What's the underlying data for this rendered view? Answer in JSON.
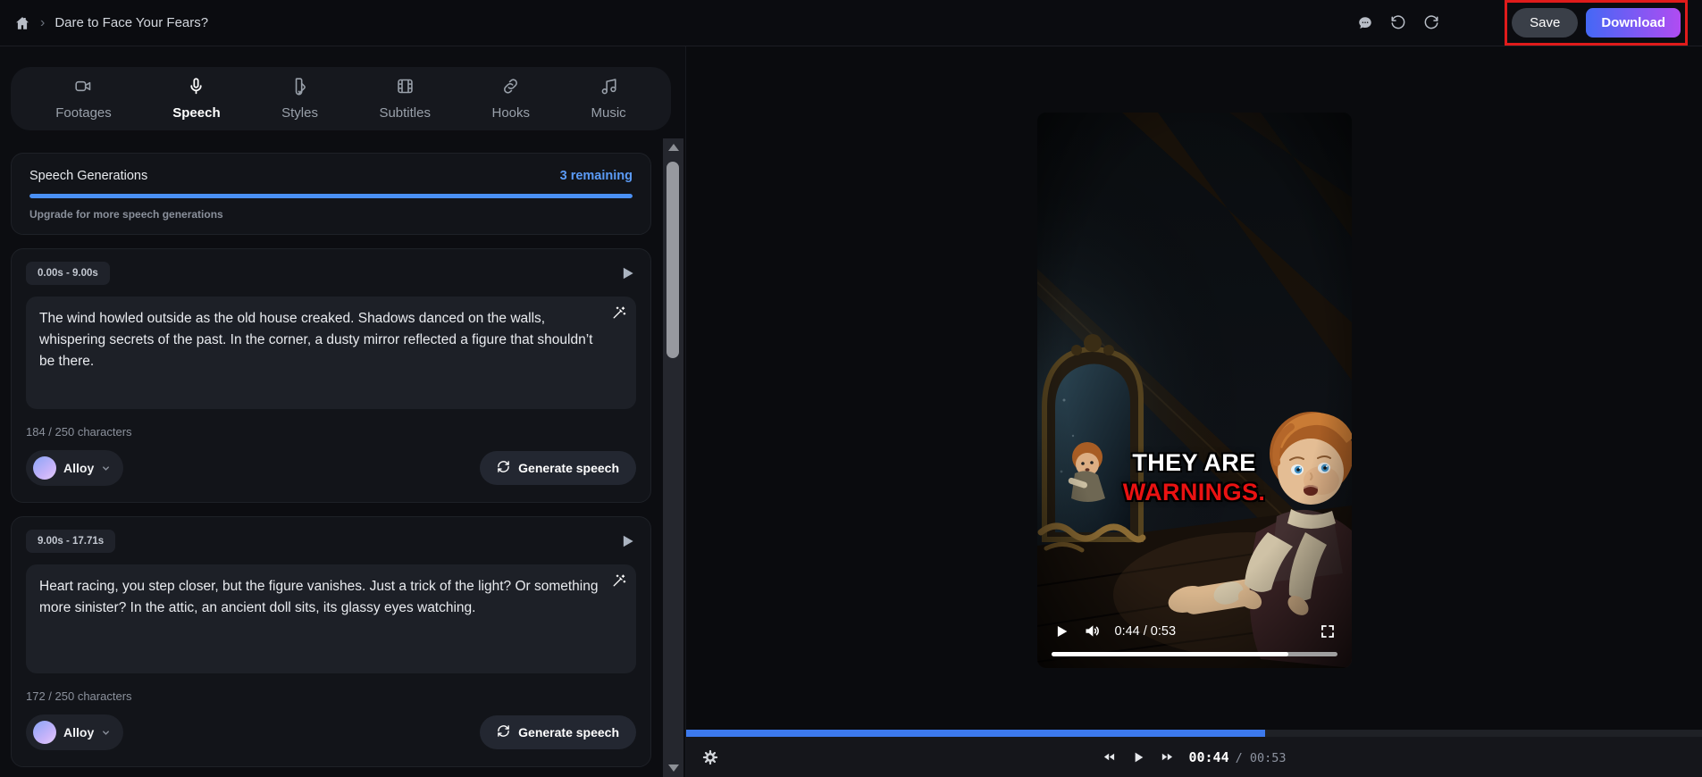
{
  "header": {
    "breadcrumb_title": "Dare to Face Your Fears?",
    "save_label": "Save",
    "download_label": "Download"
  },
  "icons": {
    "breadcrumb": "home-icon",
    "header_right": [
      "message-icon",
      "undo-icon",
      "redo-icon"
    ],
    "segment": [
      "play-icon",
      "magic-wand-icon",
      "refresh-icon",
      "chevron-down-icon"
    ],
    "player": [
      "play-icon",
      "volume-icon",
      "fullscreen-icon"
    ],
    "transport": [
      "gear-icon",
      "rewind-icon",
      "play-icon",
      "fast-forward-icon"
    ]
  },
  "tabs": [
    {
      "label": "Footages",
      "icon": "video-camera-icon",
      "active": false
    },
    {
      "label": "Speech",
      "icon": "microphone-icon",
      "active": true
    },
    {
      "label": "Styles",
      "icon": "palette-icon",
      "active": false
    },
    {
      "label": "Subtitles",
      "icon": "film-icon",
      "active": false
    },
    {
      "label": "Hooks",
      "icon": "link-icon",
      "active": false
    },
    {
      "label": "Music",
      "icon": "music-note-icon",
      "active": false
    }
  ],
  "speech_generations": {
    "title": "Speech Generations",
    "remaining_label": "3 remaining",
    "upgrade_label": "Upgrade for more speech generations",
    "progress_percent": 100
  },
  "segments": [
    {
      "time_range": "0.00s - 9.00s",
      "text": "The wind howled outside as the old house creaked. Shadows danced on the walls, whispering secrets of the past. In the corner, a dusty mirror reflected a figure that shouldn’t be there.",
      "char_count": "184 / 250 characters",
      "voice": "Alloy",
      "generate_label": "Generate speech"
    },
    {
      "time_range": "9.00s - 17.71s",
      "text": "Heart racing, you step closer, but the figure vanishes. Just a trick of the light? Or something more sinister? In the attic, an ancient doll sits, its glassy eyes watching.",
      "char_count": "172 / 250 characters",
      "voice": "Alloy",
      "generate_label": "Generate speech"
    }
  ],
  "player": {
    "caption_line1": "THEY ARE",
    "caption_line2": "WARNINGS.",
    "time_display": "0:44 / 0:53",
    "progress_percent": 83
  },
  "timeline": {
    "progress_percent": 57,
    "current_time": "00:44",
    "total_time": "/ 00:53"
  },
  "colors": {
    "accent_blue": "#4a90f4",
    "timeline_blue": "#3c79ed",
    "remaining_blue": "#5b9bf6",
    "caption_red": "#ea1212",
    "annotation_red": "#e01b1b",
    "download_gradient_start": "#4468f5",
    "download_gradient_end": "#b04cf2"
  }
}
